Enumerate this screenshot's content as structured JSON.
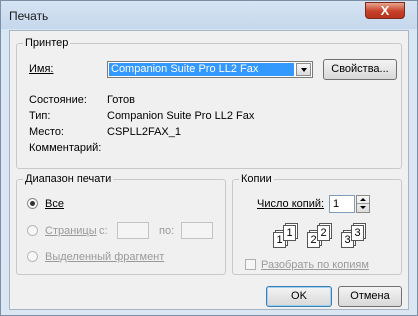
{
  "window": {
    "title": "Печать",
    "close_glyph": "X"
  },
  "printer": {
    "group_label": "Принтер",
    "name_label": "Имя:",
    "name_value": "Companion Suite Pro LL2 Fax",
    "properties_button": "Свойства...",
    "status_label": "Состояние:",
    "status_value": "Готов",
    "type_label": "Тип:",
    "type_value": "Companion Suite Pro LL2 Fax",
    "where_label": "Место:",
    "where_value": "CSPLL2FAX_1",
    "comment_label": "Комментарий:",
    "comment_value": ""
  },
  "print_range": {
    "group_label": "Диапазон печати",
    "all_label": "Все",
    "pages_label": "Страницы",
    "from_label": "с:",
    "to_label": "по:",
    "from_value": "",
    "to_value": "",
    "selection_label": "Выделенный фрагмент",
    "selected_option": "all"
  },
  "copies": {
    "group_label": "Копии",
    "count_label": "Число копий:",
    "count_value": "1",
    "collate_label": "Разобрать по копиям",
    "collate_checked": false,
    "page_digits": [
      "1",
      "1",
      "2",
      "2",
      "3",
      "3"
    ]
  },
  "buttons": {
    "ok": "OK",
    "cancel": "Отмена"
  },
  "colors": {
    "selection": "#3399ff",
    "close_button": "#c6402a"
  }
}
